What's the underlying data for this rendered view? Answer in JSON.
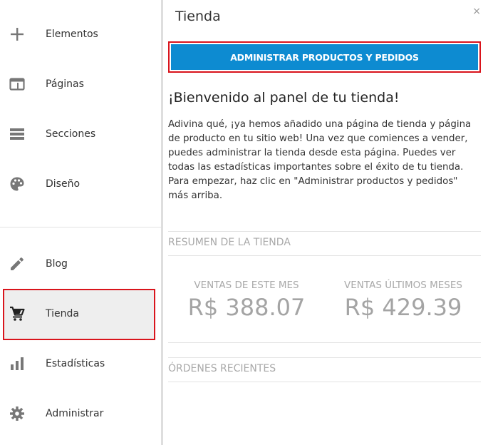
{
  "sidebar": {
    "items": [
      {
        "label": "Elementos",
        "icon": "plus-icon"
      },
      {
        "label": "Páginas",
        "icon": "browser-window-icon"
      },
      {
        "label": "Secciones",
        "icon": "sections-icon"
      },
      {
        "label": "Diseño",
        "icon": "palette-icon"
      },
      {
        "label": "Blog",
        "icon": "pencil-icon"
      },
      {
        "label": "Tienda",
        "icon": "cart-icon"
      },
      {
        "label": "Estadísticas",
        "icon": "bar-chart-icon"
      },
      {
        "label": "Administrar",
        "icon": "gear-icon"
      }
    ],
    "active": "Tienda"
  },
  "panel": {
    "title": "Tienda",
    "close": "×",
    "cta_label": "ADMINISTRAR PRODUCTOS Y PEDIDOS",
    "welcome_title": "¡Bienvenido al panel de tu tienda!",
    "intro_text": "Adivina qué, ¡ya hemos añadido una página de tienda y página de producto en tu sitio web! Una vez que comiences a vender, puedes administrar la tienda desde esta página. Puedes ver todas las estadísticas importantes sobre el éxito de tu tienda. Para empezar, haz clic en \"Administrar productos y pedidos\" más arriba.",
    "summary_title": "RESUMEN DE LA TIENDA",
    "stats": [
      {
        "label": "VENTAS DE ESTE MES",
        "value": "R$ 388.07"
      },
      {
        "label": "VENTAS ÚLTIMOS MESES",
        "value": "R$ 429.39"
      }
    ],
    "orders_title": "ÓRDENES RECIENTES"
  },
  "colors": {
    "accent": "#0d8bd1",
    "highlight": "#d9141c",
    "muted_text": "#a9a9a9",
    "icon": "#777777"
  }
}
